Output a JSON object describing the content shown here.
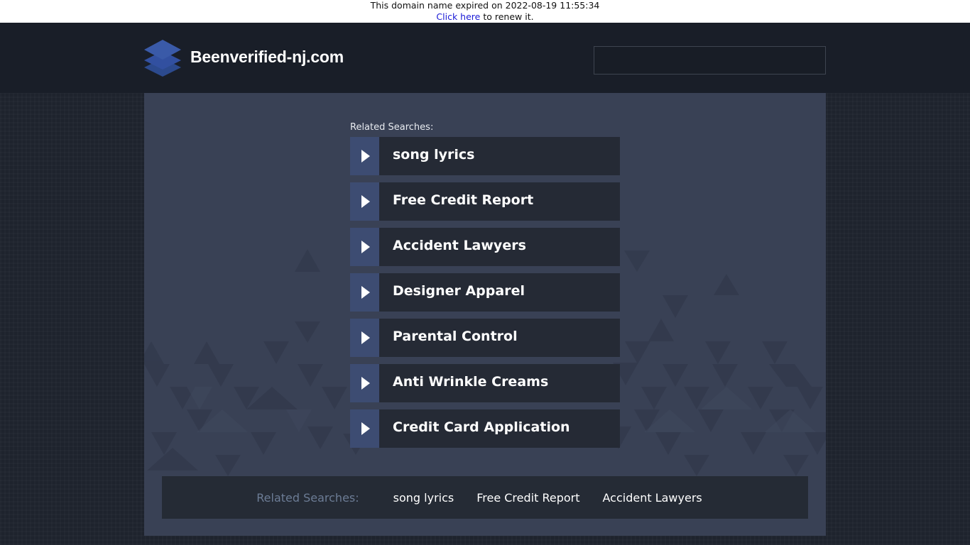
{
  "banner": {
    "expired_text": "This domain name expired on 2022-08-19 11:55:34",
    "renew_link": "Click here",
    "renew_suffix": " to renew it."
  },
  "header": {
    "logo_icon": "stacked-layers-icon",
    "site_name": "Beenverified-nj.com",
    "search_value": ""
  },
  "main": {
    "related_label": "Related Searches:",
    "links": [
      {
        "label": "song lyrics",
        "icon": "play-arrow-icon"
      },
      {
        "label": "Free Credit Report",
        "icon": "play-arrow-icon"
      },
      {
        "label": "Accident Lawyers",
        "icon": "play-arrow-icon"
      },
      {
        "label": "Designer Apparel",
        "icon": "play-arrow-icon"
      },
      {
        "label": "Parental Control",
        "icon": "play-arrow-icon"
      },
      {
        "label": "Anti Wrinkle Creams",
        "icon": "play-arrow-icon"
      },
      {
        "label": "Credit Card Application",
        "icon": "play-arrow-icon"
      }
    ]
  },
  "footer": {
    "related_label": "Related Searches:",
    "links": [
      "song lyrics",
      "Free Credit Report",
      "Accident Lawyers"
    ]
  },
  "colors": {
    "header_bg": "#191e28",
    "panel_bg": "#394155",
    "arrow_bg": "#3d4c72",
    "item_bg": "#252a35",
    "logo_blue": "#3a5aa8",
    "footer_label": "#6c7c95"
  }
}
